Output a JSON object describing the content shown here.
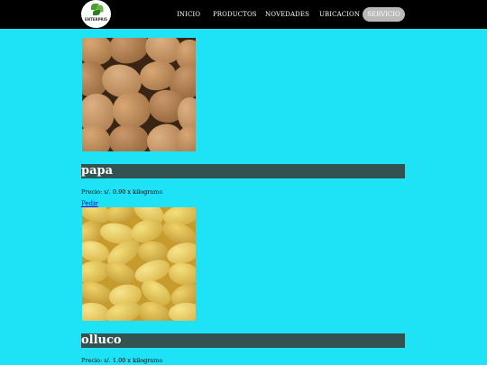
{
  "header": {
    "logo_text": "ENTERPRIS",
    "nav": {
      "inicio": "INICIO",
      "productos": "PRODUCTOS",
      "novedades": "NOVEDADES",
      "ubicacion": "UBICACION",
      "servicio": "SERVICIO"
    }
  },
  "colors": {
    "page_background": "#1ee3f7",
    "topbar": "#000000",
    "title_bar": "#335252",
    "service_button": "#b9b9b9",
    "link": "#0000ee"
  },
  "products": [
    {
      "name": "papa",
      "price": "Precio: s/. 0.90 x kilogramo",
      "order_label": "Pedir",
      "image": "potatoes-photo"
    },
    {
      "name": "olluco",
      "price": "Precio: s/. 1.00 x kilogramo",
      "image": "olluco-photo"
    }
  ]
}
